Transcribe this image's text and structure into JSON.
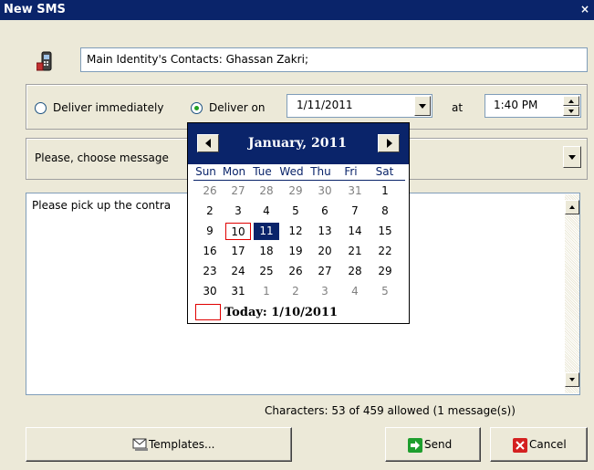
{
  "window": {
    "title": "New SMS",
    "close_glyph": "×"
  },
  "recipient": {
    "icon": "phone-contact-icon",
    "value": "Main Identity's Contacts: Ghassan Zakri;"
  },
  "delivery": {
    "option_immediate": "Deliver immediately",
    "option_on": "Deliver on",
    "selected": "on",
    "date": "1/11/2011",
    "at_label": "at",
    "time": "1:40 PM"
  },
  "template_select": {
    "placeholder": "Please, choose message"
  },
  "message": {
    "text": "Please pick up the contra"
  },
  "calendar": {
    "month_label": "January, 2011",
    "weekdays": [
      "Sun",
      "Mon",
      "Tue",
      "Wed",
      "Thu",
      "Fri",
      "Sat"
    ],
    "weeks": [
      [
        "26",
        "27",
        "28",
        "29",
        "30",
        "31",
        "1"
      ],
      [
        "2",
        "3",
        "4",
        "5",
        "6",
        "7",
        "8"
      ],
      [
        "9",
        "10",
        "11",
        "12",
        "13",
        "14",
        "15"
      ],
      [
        "16",
        "17",
        "18",
        "19",
        "20",
        "21",
        "22"
      ],
      [
        "23",
        "24",
        "25",
        "26",
        "27",
        "28",
        "29"
      ],
      [
        "30",
        "31",
        "1",
        "2",
        "3",
        "4",
        "5"
      ]
    ],
    "selected_day": "11",
    "today_day": "10",
    "today_label": "Today: 1/10/2011"
  },
  "status": {
    "characters": "Characters: 53 of 459 allowed (1 message(s))"
  },
  "buttons": {
    "templates": "Templates...",
    "send": "Send",
    "cancel": "Cancel"
  },
  "colors": {
    "titlebar": "#0a246a",
    "window_bg": "#ece9d8",
    "selection": "#0a246a",
    "today_border": "#e00000"
  }
}
